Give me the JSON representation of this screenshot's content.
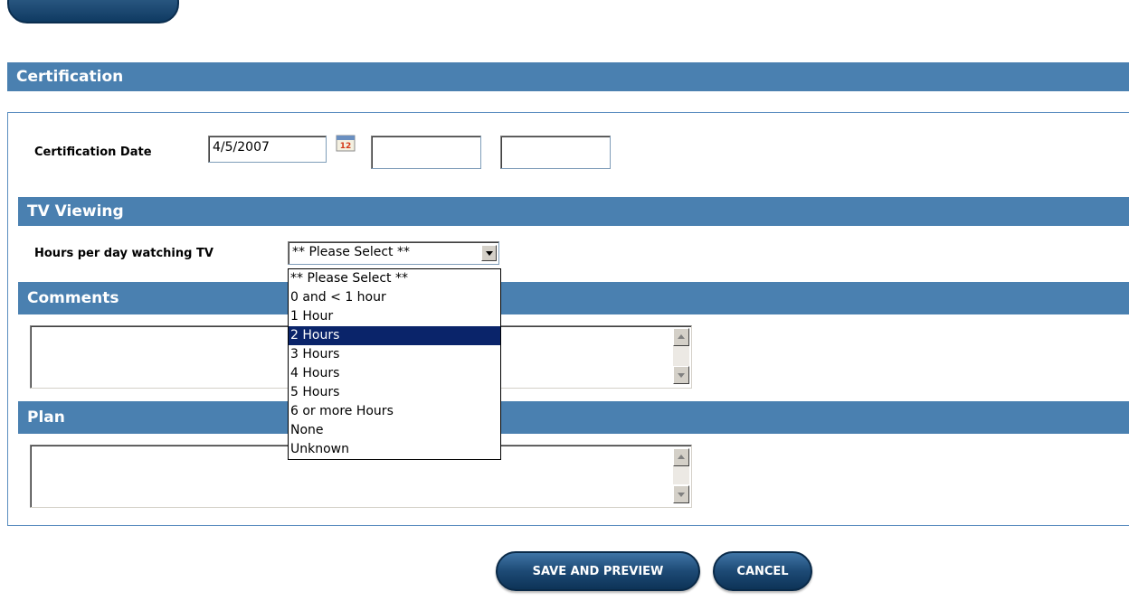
{
  "sections": {
    "certification": "Certification",
    "tv_viewing": "TV Viewing",
    "comments": "Comments",
    "plan": "Plan"
  },
  "certification": {
    "date_label": "Certification Date",
    "date_value": "4/5/2007",
    "extra1_value": "",
    "extra2_value": ""
  },
  "tv": {
    "hours_label": "Hours per day watching TV",
    "selected_value": "** Please Select **",
    "options": [
      "** Please Select **",
      "0 and < 1 hour",
      "1 Hour",
      "2 Hours",
      "3 Hours",
      "4 Hours",
      "5 Hours",
      "6 or more Hours",
      "None",
      "Unknown"
    ],
    "highlighted_index": 3
  },
  "buttons": {
    "save_preview": "SAVE AND PREVIEW",
    "cancel": "CANCEL"
  },
  "colors": {
    "section_bar": "#4a80b0",
    "button": "#1d4a75",
    "highlight": "#0a246a"
  }
}
